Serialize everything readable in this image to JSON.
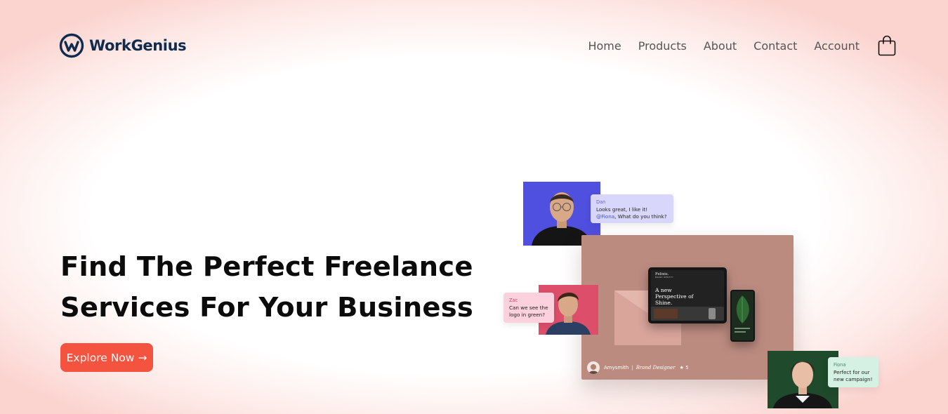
{
  "brand": {
    "name": "WorkGenius",
    "color": "#0f2c4e"
  },
  "nav": {
    "items": [
      {
        "label": "Home"
      },
      {
        "label": "Products"
      },
      {
        "label": "About"
      },
      {
        "label": "Contact"
      },
      {
        "label": "Account"
      }
    ],
    "cart_icon": "shopping-bag-icon"
  },
  "hero": {
    "title_line1": "Find The Perfect Freelance",
    "title_line2": "Services For Your Business",
    "cta_label": "Explore Now →",
    "cta_color": "#f4533f"
  },
  "illustration": {
    "chat_dan": {
      "name": "Dan",
      "line1": "Looks great, I like it!",
      "mention": "@Fiona",
      "line2_rest": ", What do you think?"
    },
    "chat_zac": {
      "name": "Zac",
      "text": "Can we see the logo in green?"
    },
    "chat_fiona": {
      "name": "Fiona",
      "text": "Perfect for our new campaign!"
    },
    "tablet": {
      "brand": "Felixis.",
      "subtitle": "BRAND IDENTITY",
      "headline": "A new Perspective of Shine."
    },
    "card": {
      "author": "Amysmith",
      "role": "Brand Designer",
      "rating": "★ 5"
    },
    "colors": {
      "card": "#bc8b7f",
      "dan_bg": "#4f4fe0",
      "zac_bg": "#dc4e6a",
      "fiona_bg": "#1f4a2c"
    }
  }
}
